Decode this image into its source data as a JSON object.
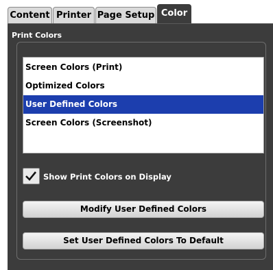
{
  "tabs": [
    {
      "label": "Content",
      "active": false
    },
    {
      "label": "Printer",
      "active": false
    },
    {
      "label": "Page Setup",
      "active": false
    },
    {
      "label": "Color",
      "active": true
    }
  ],
  "group": {
    "title": "Print Colors"
  },
  "list": {
    "items": [
      "Screen Colors (Print)",
      "Optimized Colors",
      "User Defined Colors",
      "Screen Colors (Screenshot)"
    ],
    "selected_index": 2
  },
  "checkbox": {
    "label": "Show Print Colors on Display",
    "checked": true
  },
  "buttons": {
    "modify": "Modify User Defined Colors",
    "set_default": "Set User Defined Colors To Default"
  },
  "colors": {
    "panel_bg": "#3c3c3c",
    "selection": "#1c3eae",
    "tab_inactive": "#dadada"
  }
}
